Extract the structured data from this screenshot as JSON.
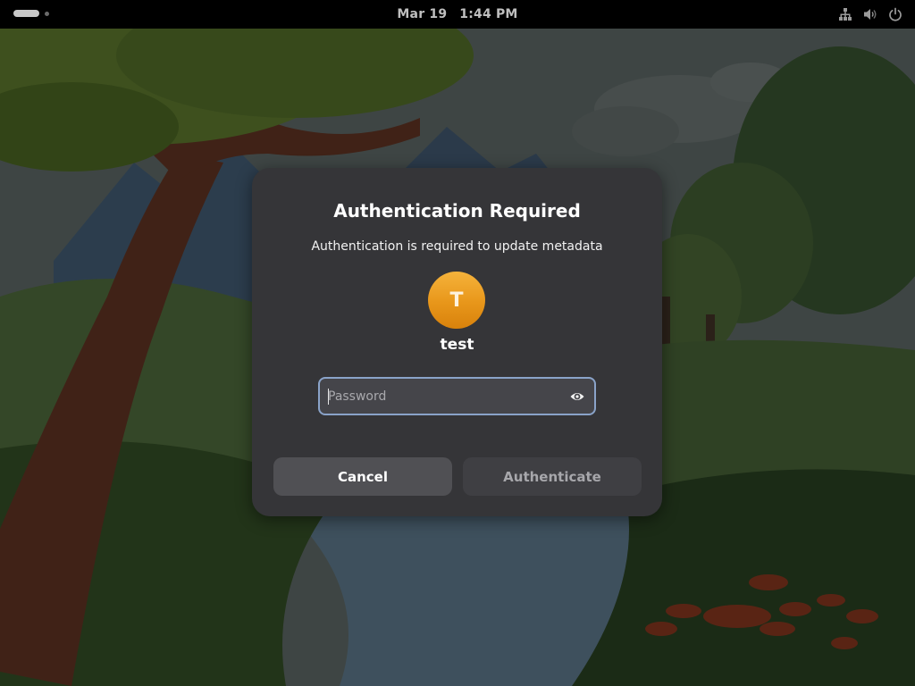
{
  "topbar": {
    "date": "Mar 19",
    "time": "1:44 PM",
    "icons": [
      "network-wired-icon",
      "volume-icon",
      "power-icon"
    ]
  },
  "dialog": {
    "title": "Authentication Required",
    "description": "Authentication is required to update metadata",
    "avatar_initial": "T",
    "username": "test",
    "password_placeholder": "Password",
    "password_value": "",
    "cancel_label": "Cancel",
    "authenticate_label": "Authenticate",
    "authenticate_enabled": false
  },
  "colors": {
    "dialog_bg": "#353538",
    "field_focus_border": "#8aa3c9",
    "avatar_orange": "#e8961a",
    "button_bg": "#505054"
  }
}
